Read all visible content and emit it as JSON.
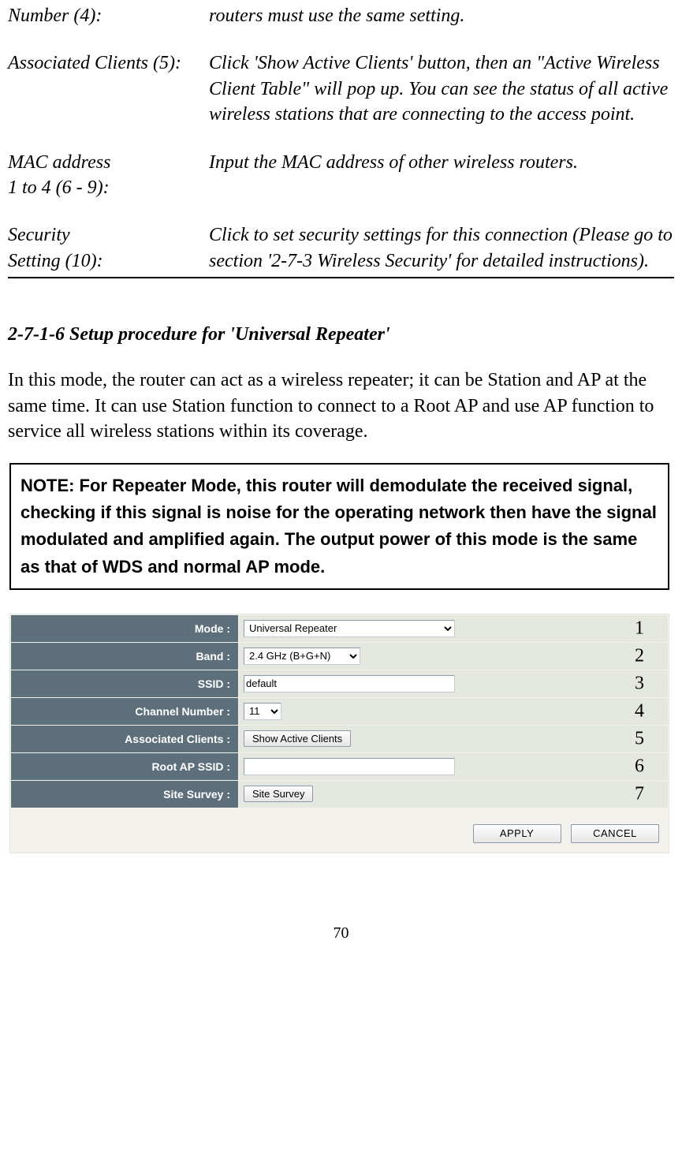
{
  "definitions": [
    {
      "term": "Number (4):",
      "defn": "routers must use the same setting."
    },
    {
      "term": "Associated Clients (5):",
      "defn": "Click 'Show Active Clients' button, then an \"Active Wireless Client Table\" will pop up. You can see the status of all active wireless stations that are connecting to the access point."
    },
    {
      "term": "MAC address\n1 to 4 (6 - 9):",
      "defn": "Input the MAC address of other wireless routers."
    },
    {
      "term": "Security\nSetting (10):",
      "defn": "Click to set security settings for this connection (Please go to section '2-7-3 Wireless Security' for detailed instructions)."
    }
  ],
  "section_heading": "2-7-1-6 Setup procedure for 'Universal Repeater'",
  "paragraph": "In this mode, the router can act as a wireless repeater; it can be Station and AP at the same time. It can use Station function to connect to a Root AP and use AP function to service all wireless stations within its coverage.",
  "note": "NOTE: For Repeater Mode, this router will demodulate the received signal, checking if this signal is noise for the operating network then have the signal modulated and amplified again. The output power of this mode is the same as that of WDS and normal AP mode.",
  "settings": {
    "rows": [
      {
        "label": "Mode :",
        "type": "select",
        "cls": "sel-mode",
        "value": "Universal Repeater",
        "callout": "1"
      },
      {
        "label": "Band :",
        "type": "select",
        "cls": "sel-band",
        "value": "2.4 GHz (B+G+N)",
        "callout": "2"
      },
      {
        "label": "SSID :",
        "type": "text",
        "cls": "txt-wide",
        "value": "default",
        "callout": "3"
      },
      {
        "label": "Channel Number :",
        "type": "select",
        "cls": "sel-chan",
        "value": "11",
        "callout": "4"
      },
      {
        "label": "Associated Clients :",
        "type": "button",
        "btn_label": "Show Active Clients",
        "callout": "5"
      },
      {
        "label": "Root AP SSID :",
        "type": "text",
        "cls": "txt-wide",
        "value": "",
        "callout": "6"
      },
      {
        "label": "Site Survey :",
        "type": "button",
        "btn_label": "Site Survey",
        "callout": "7"
      }
    ]
  },
  "actions": {
    "apply": "APPLY",
    "cancel": "CANCEL"
  },
  "page_number": "70"
}
